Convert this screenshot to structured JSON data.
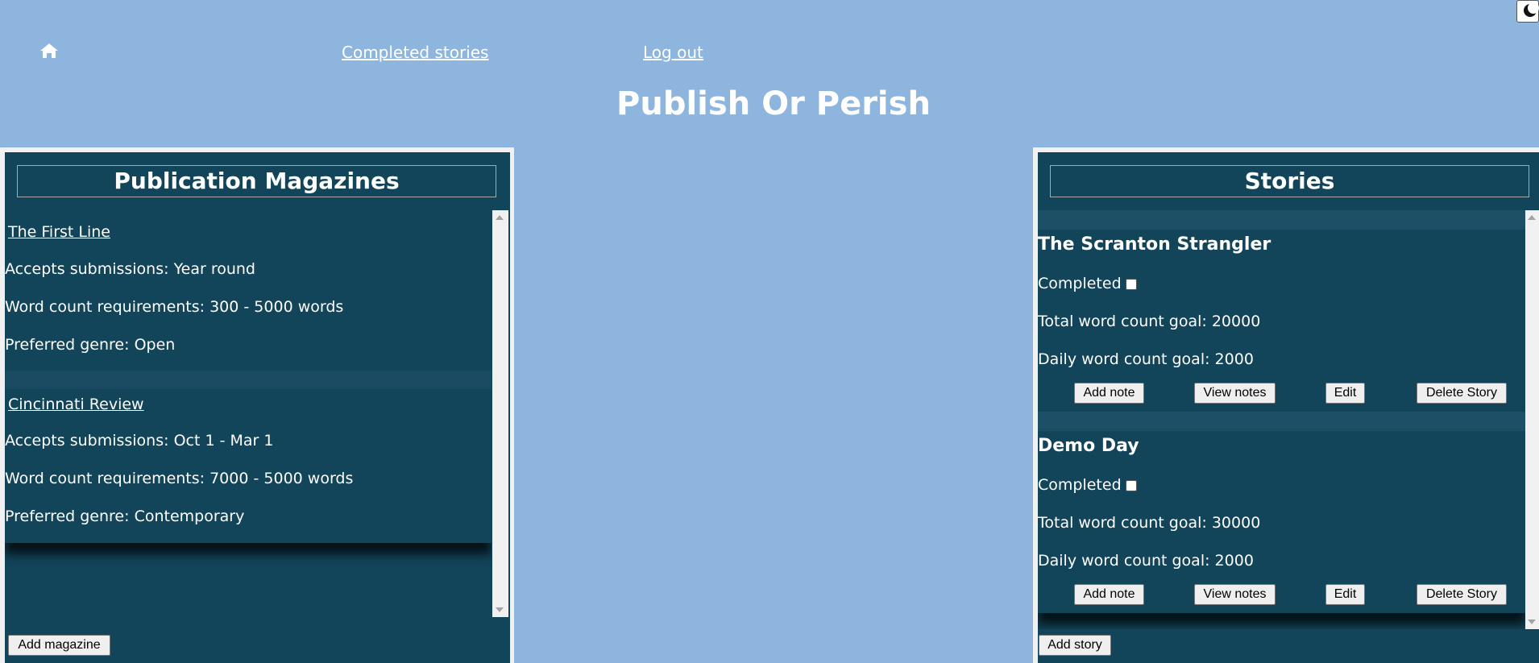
{
  "nav": {
    "home_icon": "home-icon",
    "completed_label": "Completed stories",
    "logout_label": "Log out",
    "theme_icon": "moon-icon"
  },
  "site_title": "Publish Or Perish",
  "magazines": {
    "header": "Publication Magazines",
    "items": [
      {
        "name": "The First Line",
        "submissions": "Accepts submissions: Year round",
        "word_count": "Word count requirements: 300 - 5000 words",
        "genre": "Preferred genre: Open"
      },
      {
        "name": "Cincinnati Review",
        "submissions": "Accepts submissions: Oct 1 - Mar 1",
        "word_count": "Word count requirements: 7000 - 5000 words",
        "genre": "Preferred genre: Contemporary"
      }
    ],
    "add_label": "Add magazine"
  },
  "stories": {
    "header": "Stories",
    "items": [
      {
        "title": "The Scranton Strangler",
        "completed_label": "Completed",
        "completed": false,
        "total_goal": "Total word count goal: 20000",
        "daily_goal": "Daily word count goal: 2000"
      },
      {
        "title": "Demo Day",
        "completed_label": "Completed",
        "completed": false,
        "total_goal": "Total word count goal: 30000",
        "daily_goal": "Daily word count goal: 2000"
      }
    ],
    "buttons": {
      "add_note": "Add note",
      "view_notes": "View notes",
      "edit": "Edit",
      "delete": "Delete Story"
    },
    "add_label": "Add story"
  },
  "colors": {
    "background": "#8db5de",
    "panel": "#12445a",
    "text": "#ffffff"
  }
}
